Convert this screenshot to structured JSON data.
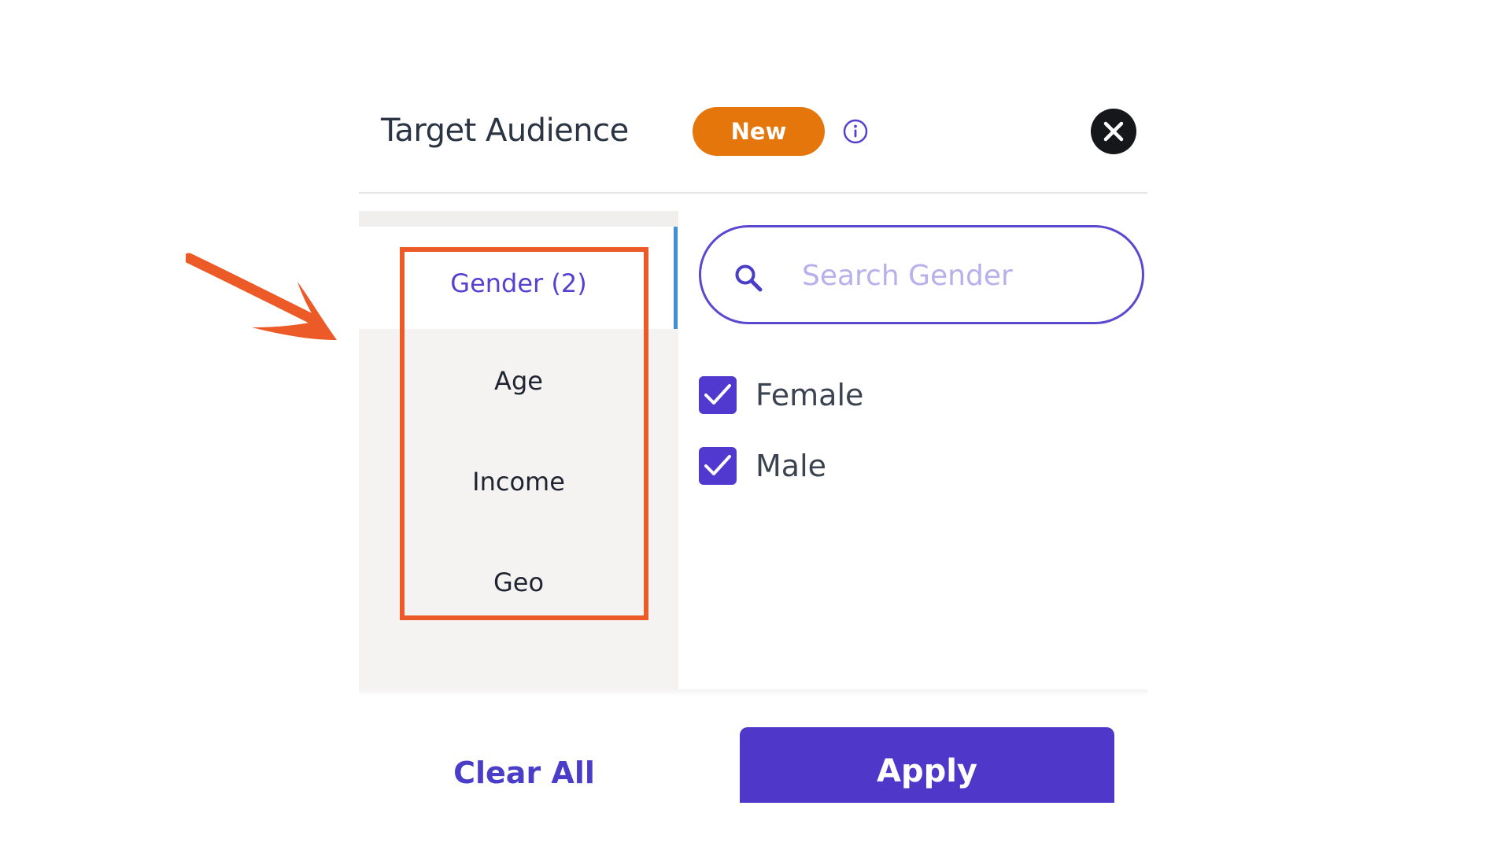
{
  "header": {
    "title": "Target Audience",
    "badge": "New",
    "info_icon": "info-circle-icon",
    "close_icon": "close-icon"
  },
  "sidebar": {
    "items": [
      {
        "label": "Gender (2)",
        "active": true
      },
      {
        "label": "Age",
        "active": false
      },
      {
        "label": "Income",
        "active": false
      },
      {
        "label": "Geo",
        "active": false
      }
    ]
  },
  "search": {
    "placeholder": "Search Gender",
    "value": "",
    "icon": "search-icon"
  },
  "options": [
    {
      "label": "Female",
      "checked": true
    },
    {
      "label": "Male",
      "checked": true
    }
  ],
  "footer": {
    "clear_label": "Clear All",
    "apply_label": "Apply"
  },
  "colors": {
    "accent": "#4f37c9",
    "badge": "#e4760c",
    "annotation": "#ec5a28",
    "active_tab_text": "#5640cf",
    "sidebar_bg": "#f5f2f2"
  }
}
